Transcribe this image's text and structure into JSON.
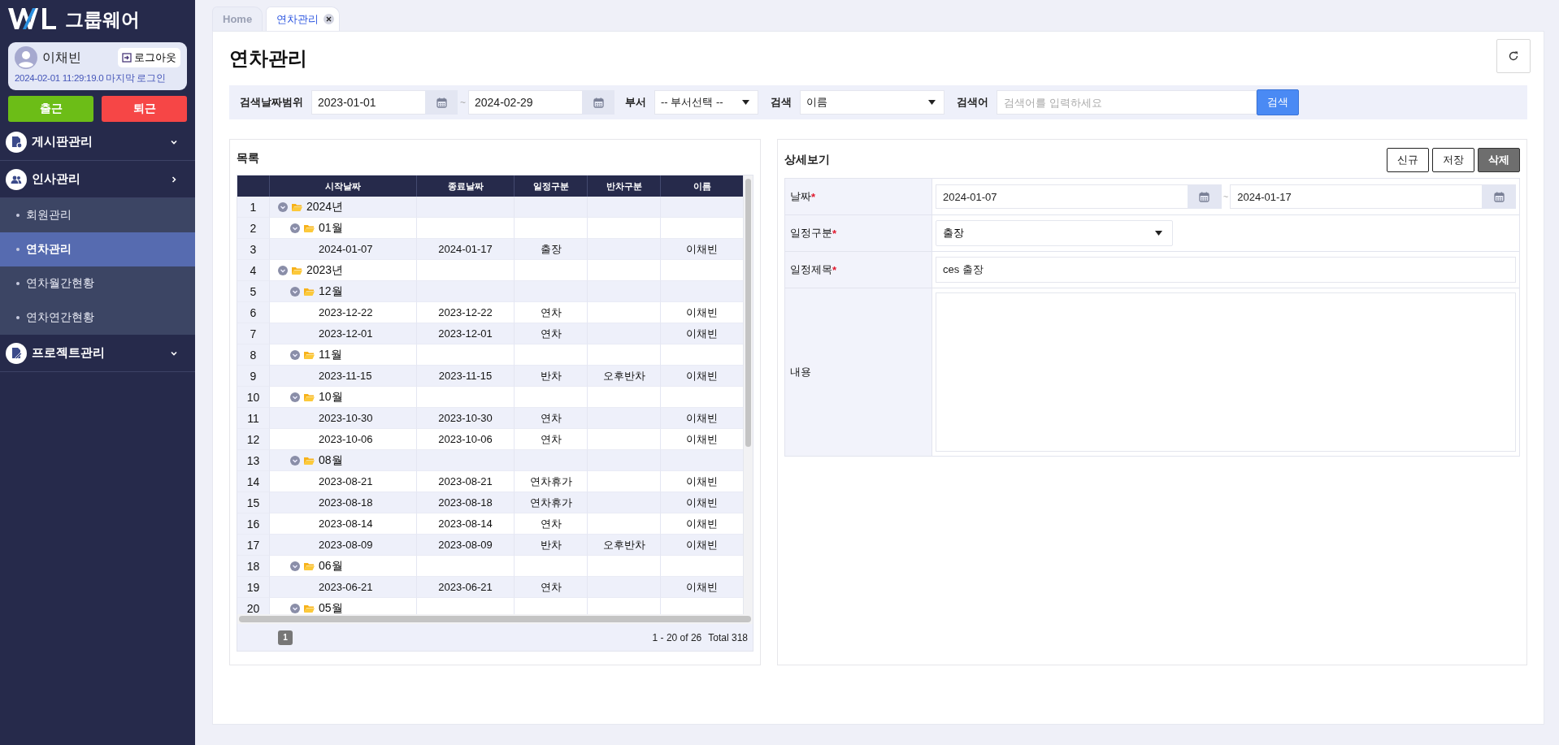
{
  "sidebar": {
    "app_name": "그룹웨어",
    "user": {
      "name": "이채빈",
      "logout": "로그아웃",
      "last_login": "2024-02-01 11:29:19.0 마지막 로그인"
    },
    "attendance_buttons": [
      {
        "label": "출근",
        "kind": "in"
      },
      {
        "label": "퇴근",
        "kind": "out"
      }
    ],
    "menu": [
      {
        "label": "게시판관리",
        "expanded": false
      },
      {
        "label": "인사관리",
        "expanded": true,
        "children": [
          {
            "label": "회원관리",
            "selected": false
          },
          {
            "label": "연차관리",
            "selected": true
          },
          {
            "label": "연차월간현황",
            "selected": false
          },
          {
            "label": "연차연간현황",
            "selected": false
          }
        ]
      },
      {
        "label": "프로젝트관리",
        "expanded": false
      }
    ]
  },
  "tabs": [
    {
      "label": "Home",
      "selected": false,
      "closable": false
    },
    {
      "label": "연차관리",
      "selected": true,
      "closable": true
    }
  ],
  "page": {
    "title": "연차관리"
  },
  "filter": {
    "date_label": "검색날짜범위",
    "date_from": "2023-01-01",
    "separator": "~",
    "date_to": "2024-02-29",
    "dept_label": "부서",
    "dept_value": "-- 부서선택 --",
    "search_label": "검색",
    "search_value": "이름",
    "keyword_label": "검색어",
    "keyword_placeholder": "검색어를 입력하세요",
    "search_button": "검색"
  },
  "list": {
    "title": "목록",
    "columns": [
      "시작날짜",
      "종료날짜",
      "일정구분",
      "반차구분",
      "이름"
    ],
    "rows": [
      {
        "no": "1",
        "label": "2024년",
        "expanded": true,
        "children": [
          {
            "no": "2",
            "label": "01월",
            "expanded": true,
            "children": [
              {
                "no": "3",
                "start": "2024-01-07",
                "end": "2024-01-17",
                "type": "출장",
                "name": "이채빈"
              }
            ]
          }
        ]
      },
      {
        "no": "4",
        "label": "2023년",
        "expanded": true,
        "children": [
          {
            "no": "5",
            "label": "12월",
            "expanded": true,
            "children": [
              {
                "no": "6",
                "start": "2023-12-22",
                "end": "2023-12-22",
                "type": "연차",
                "name": "이채빈"
              },
              {
                "no": "7",
                "start": "2023-12-01",
                "end": "2023-12-01",
                "type": "연차",
                "name": "이채빈"
              }
            ]
          },
          {
            "no": "8",
            "label": "11월",
            "expanded": true,
            "children": [
              {
                "no": "9",
                "start": "2023-11-15",
                "end": "2023-11-15",
                "type": "반차",
                "half": "오후반차",
                "name": "이채빈"
              }
            ]
          },
          {
            "no": "10",
            "label": "10월",
            "expanded": true,
            "children": [
              {
                "no": "11",
                "start": "2023-10-30",
                "end": "2023-10-30",
                "type": "연차",
                "name": "이채빈"
              },
              {
                "no": "12",
                "start": "2023-10-06",
                "end": "2023-10-06",
                "type": "연차",
                "name": "이채빈"
              }
            ]
          },
          {
            "no": "13",
            "label": "08월",
            "expanded": true,
            "children": [
              {
                "no": "14",
                "start": "2023-08-21",
                "end": "2023-08-21",
                "type": "연차휴가",
                "name": "이채빈"
              },
              {
                "no": "15",
                "start": "2023-08-18",
                "end": "2023-08-18",
                "type": "연차휴가",
                "name": "이채빈"
              },
              {
                "no": "16",
                "start": "2023-08-14",
                "end": "2023-08-14",
                "type": "연차",
                "name": "이채빈"
              },
              {
                "no": "17",
                "start": "2023-08-09",
                "end": "2023-08-09",
                "type": "반차",
                "half": "오후반차",
                "name": "이채빈"
              }
            ]
          },
          {
            "no": "18",
            "label": "06월",
            "expanded": true,
            "children": [
              {
                "no": "19",
                "start": "2023-06-21",
                "end": "2023-06-21",
                "type": "연차",
                "name": "이채빈"
              }
            ]
          },
          {
            "no": "20",
            "label": "05월",
            "expanded": true
          }
        ]
      }
    ],
    "pager": {
      "pages": [
        {
          "label": "1",
          "selected": true
        }
      ],
      "summary": "1 - 20 of 26",
      "total": "Total 318"
    }
  },
  "detail": {
    "title": "상세보기",
    "buttons": [
      {
        "label": "신규",
        "kind": "outline"
      },
      {
        "label": "저장",
        "kind": "outline"
      },
      {
        "label": "삭제",
        "kind": "dark"
      }
    ],
    "fields": [
      {
        "kind": "date_range",
        "label": "날짜",
        "mark": "*",
        "from": "2024-01-07",
        "separator": "~",
        "to": "2024-01-17"
      },
      {
        "kind": "select",
        "label": "일정구분",
        "mark": "*",
        "value": "출장"
      },
      {
        "kind": "text",
        "label": "일정제목",
        "mark": "*",
        "value": "ces 출장"
      },
      {
        "kind": "textarea",
        "label": "내용"
      }
    ]
  }
}
